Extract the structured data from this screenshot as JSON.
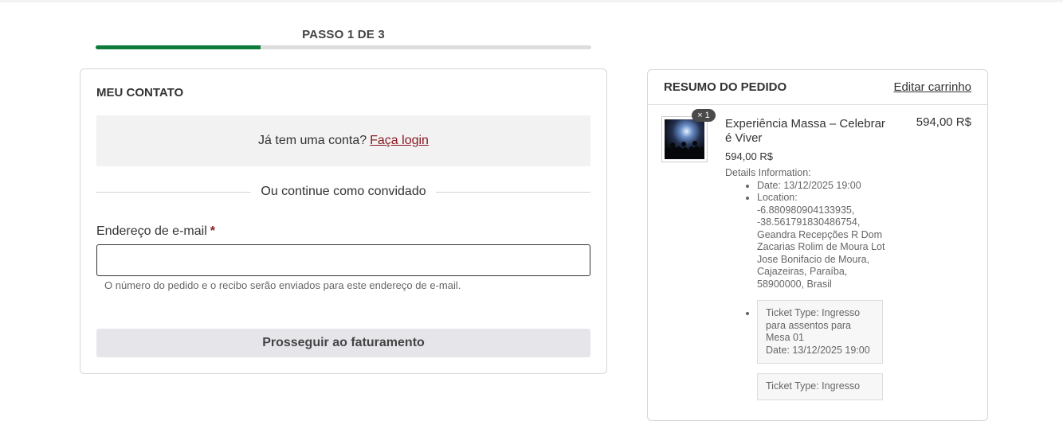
{
  "progress": {
    "label": "PASSO 1 DE 3",
    "fraction": 0.333
  },
  "contact": {
    "title": "MEU CONTATO",
    "login_prompt": "Já tem uma conta?",
    "login_link": "Faça login",
    "guest_divider": "Ou continue como convidado",
    "email_label": "Endereço de e-mail",
    "required_mark": "*",
    "email_value": "",
    "email_help": "O número do pedido e o recibo serão enviados para este endereço de e-mail.",
    "submit_label": "Prosseguir ao faturamento"
  },
  "summary": {
    "title": "RESUMO DO PEDIDO",
    "edit_cart": "Editar carrinho",
    "item": {
      "qty_badge": "× 1",
      "name": "Experiência Massa – Celebrar é Viver",
      "unit_price": "594,00 R$",
      "total_price": "594,00 R$",
      "details_heading": "Details Information:",
      "date": "Date: 13/12/2025 19:00",
      "location": "Location: -6.880980904133935, -38.561791830486754, Geandra Recepções R Dom Zacarias Rolim de Moura Lot Jose Bonifacio de Moura, Cajazeiras, Paraíba, 58900000, Brasil",
      "tickets": [
        {
          "type": "Ticket Type: Ingresso para assentos para Mesa 01",
          "date": "Date: 13/12/2025 19:00"
        },
        {
          "type": "Ticket Type: Ingresso",
          "date": ""
        }
      ]
    }
  },
  "colors": {
    "accent_green": "#0d7a3e",
    "link_red": "#8a1a22",
    "button_bg": "#e6e5ea"
  },
  "icons": {
    "product_thumbnail": "concert-image"
  }
}
